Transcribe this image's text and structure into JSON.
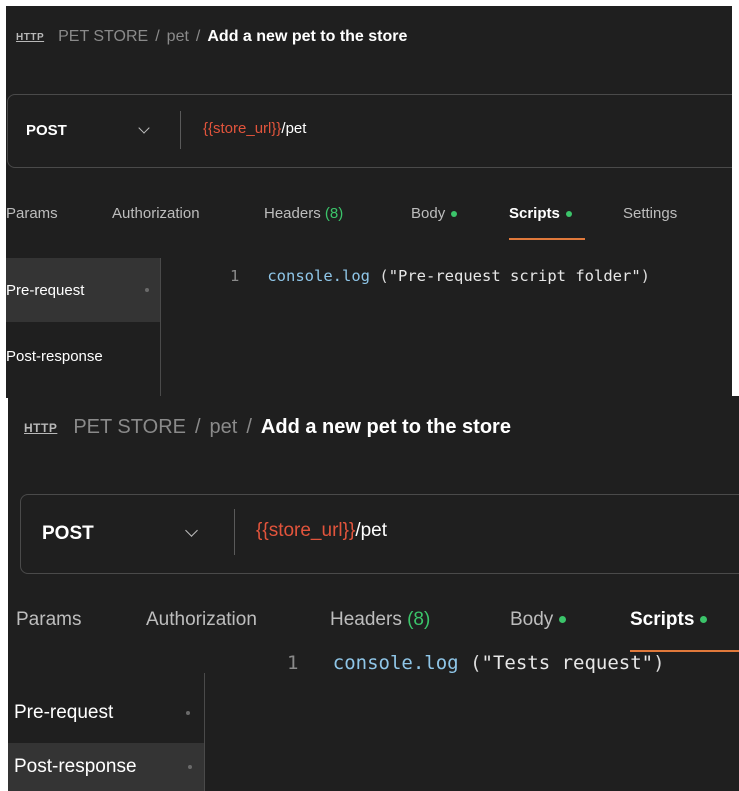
{
  "panels": [
    {
      "breadcrumb": {
        "icon": "HTTP",
        "collection": "PET STORE",
        "folder": "pet",
        "separator": "/",
        "title": "Add a new pet to the store"
      },
      "request": {
        "method": "POST",
        "url_variable": "{{store_url}}",
        "url_path": "/pet"
      },
      "tabs": [
        {
          "label": "Params"
        },
        {
          "label": "Authorization"
        },
        {
          "label": "Headers",
          "count": "(8)"
        },
        {
          "label": "Body"
        },
        {
          "label": "Scripts"
        },
        {
          "label": "Settings"
        }
      ],
      "active_tab": "Scripts",
      "sidebar": [
        {
          "label": "Pre-request",
          "selected": true
        },
        {
          "label": "Post-response",
          "selected": false
        }
      ],
      "editor": {
        "line_number": "1",
        "identifier": "console.log",
        "open": "(",
        "string": "\"Pre-request script folder\"",
        "close": ")"
      }
    },
    {
      "breadcrumb": {
        "icon": "HTTP",
        "collection": "PET STORE",
        "folder": "pet",
        "separator": "/",
        "title": "Add a new pet to the store"
      },
      "request": {
        "method": "POST",
        "url_variable": "{{store_url}}",
        "url_path": "/pet"
      },
      "tabs": [
        {
          "label": "Params"
        },
        {
          "label": "Authorization"
        },
        {
          "label": "Headers",
          "count": "(8)"
        },
        {
          "label": "Body"
        },
        {
          "label": "Scripts"
        }
      ],
      "active_tab": "Scripts",
      "sidebar": [
        {
          "label": "Pre-request",
          "selected": false
        },
        {
          "label": "Post-response",
          "selected": true
        }
      ],
      "editor": {
        "line_number": "1",
        "identifier": "console.log",
        "open": "(",
        "string": "\"Tests request\"",
        "close": ")"
      }
    }
  ],
  "colors": {
    "background": "#1f1f1f",
    "url_variable": "#e2543c",
    "status_dot": "#3bc46a",
    "active_underline": "#e0793b",
    "identifier": "#8fc6e8"
  }
}
